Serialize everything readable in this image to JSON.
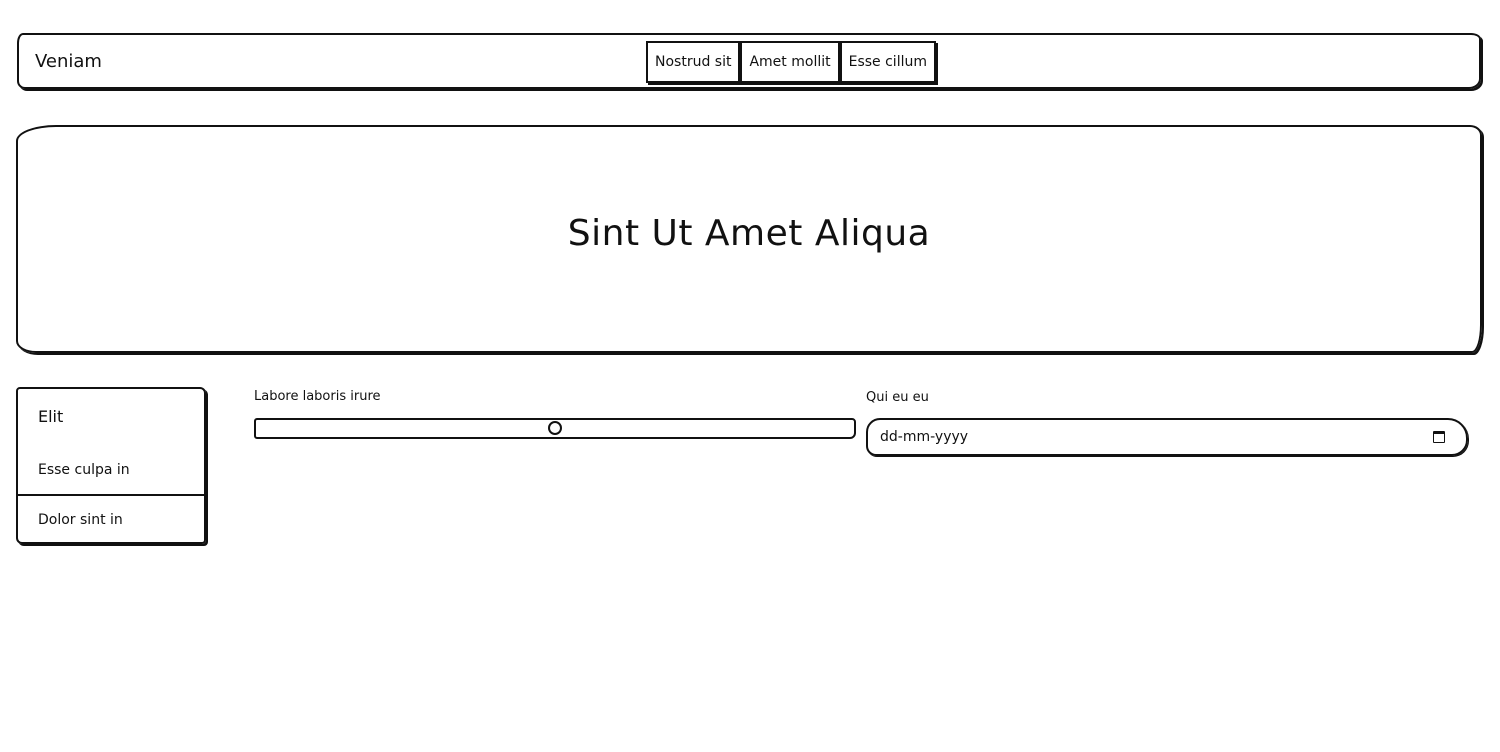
{
  "navbar": {
    "brand": "Veniam",
    "links": [
      {
        "label": "Nostrud sit"
      },
      {
        "label": "Amet mollit"
      },
      {
        "label": "Esse cillum"
      }
    ]
  },
  "hero": {
    "title": "Sint Ut Amet Aliqua"
  },
  "sidebar": {
    "header": "Elit",
    "items": [
      {
        "label": "Esse culpa in"
      },
      {
        "label": "Dolor sint in"
      }
    ]
  },
  "form": {
    "range": {
      "label": "Labore laboris irure",
      "value_fraction": 0.5
    },
    "date": {
      "label": "Qui eu eu",
      "placeholder": "dd-mm-yyyy",
      "icon": "calendar-icon"
    }
  }
}
